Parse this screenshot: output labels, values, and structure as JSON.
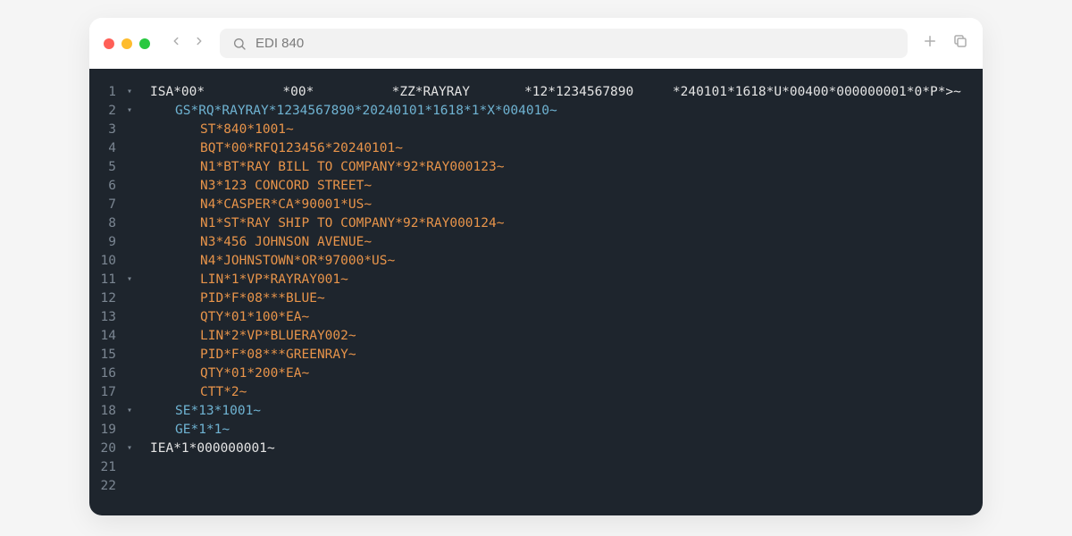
{
  "search": {
    "query": "EDI 840"
  },
  "lines": {
    "n1": "1",
    "n2": "2",
    "n3": "3",
    "n4": "4",
    "n5": "5",
    "n6": "6",
    "n7": "7",
    "n8": "8",
    "n9": "9",
    "n10": "10",
    "n11": "11",
    "n12": "12",
    "n13": "13",
    "n14": "14",
    "n15": "15",
    "n16": "16",
    "n17": "17",
    "n18": "18",
    "n19": "19",
    "n20": "20",
    "n21": "21",
    "n22": "22"
  },
  "code": {
    "l1": "ISA*00*          *00*          *ZZ*RAYRAY       *12*1234567890     *240101*1618*U*00400*000000001*0*P*>~",
    "l2": "GS*RQ*RAYRAY*1234567890*20240101*1618*1*X*004010~",
    "l3": "ST*840*1001~",
    "l4": "BQT*00*RFQ123456*20240101~",
    "l5": "N1*BT*RAY BILL TO COMPANY*92*RAY000123~",
    "l6": "N3*123 CONCORD STREET~",
    "l7": "N4*CASPER*CA*90001*US~",
    "l8": "N1*ST*RAY SHIP TO COMPANY*92*RAY000124~",
    "l9": "N3*456 JOHNSON AVENUE~",
    "l10": "N4*JOHNSTOWN*OR*97000*US~",
    "l11": "LIN*1*VP*RAYRAY001~",
    "l12": "PID*F*08***BLUE~",
    "l13": "QTY*01*100*EA~",
    "l14": "LIN*2*VP*BLUERAY002~",
    "l15": "PID*F*08***GREENRAY~",
    "l16": "QTY*01*200*EA~",
    "l17": "CTT*2~",
    "l18": "SE*13*1001~",
    "l19": "GE*1*1~",
    "l20": "IEA*1*000000001~",
    "l21": "",
    "l22": ""
  }
}
